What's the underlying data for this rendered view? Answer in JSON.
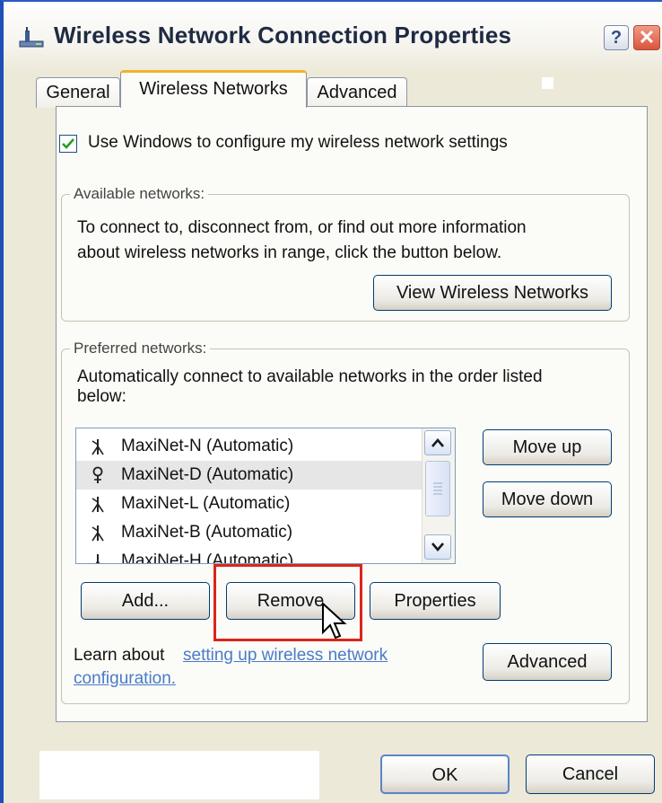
{
  "window": {
    "title": "Wireless Network Connection Properties",
    "help_label": "?",
    "close_label": "✕"
  },
  "tabs": [
    {
      "label": "General"
    },
    {
      "label": "Wireless Networks"
    },
    {
      "label": "Advanced"
    }
  ],
  "config_checkbox": {
    "checked": true,
    "label": "Use Windows to configure my wireless network settings"
  },
  "available": {
    "title": "Available networks:",
    "desc_line1": "To connect to, disconnect from, or find out more information",
    "desc_line2": "about wireless networks in range, click the button below.",
    "view_button": "View Wireless Networks"
  },
  "preferred": {
    "title": "Preferred networks:",
    "desc_line1": "Automatically connect to available networks in the order listed",
    "desc_line2": "below:",
    "items": [
      {
        "label": "MaxiNet-N (Automatic)",
        "icon": "wireless-antenna-icon"
      },
      {
        "label": "MaxiNet-D (Automatic)",
        "icon": "wireless-connected-icon"
      },
      {
        "label": "MaxiNet-L (Automatic)",
        "icon": "wireless-antenna-icon"
      },
      {
        "label": "MaxiNet-B (Automatic)",
        "icon": "wireless-antenna-icon"
      },
      {
        "label": "MaxiNet-H (Automatic)",
        "icon": "wireless-antenna-icon"
      }
    ],
    "selected_index": 1,
    "move_up": "Move up",
    "move_down": "Move down",
    "add": "Add...",
    "remove": "Remove",
    "properties": "Properties",
    "learn_prefix": "Learn about",
    "learn_link_line1": "setting up wireless network",
    "learn_link_line2": "configuration.",
    "advanced": "Advanced"
  },
  "footer": {
    "ok": "OK",
    "cancel": "Cancel"
  },
  "colors": {
    "highlight": "#d9261c",
    "link": "#4a7bc9",
    "tab_accent": "#f0b428"
  }
}
